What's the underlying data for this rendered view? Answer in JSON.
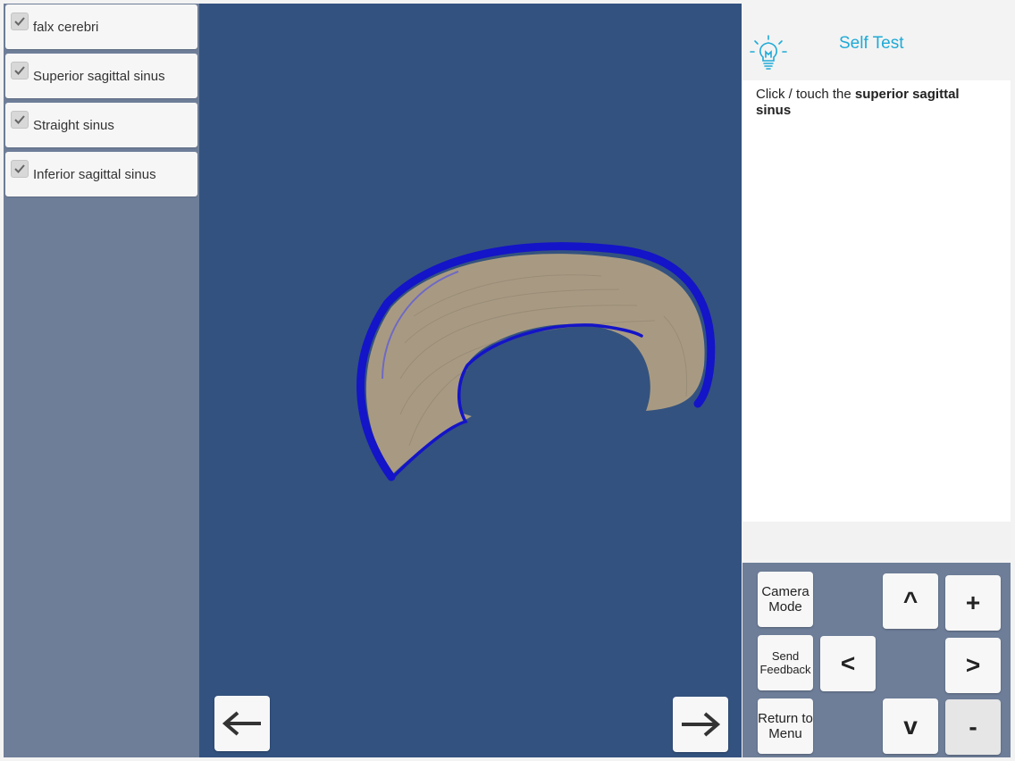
{
  "layers": [
    {
      "label": "falx cerebri",
      "checked": true
    },
    {
      "label": "Superior sagittal sinus",
      "checked": true
    },
    {
      "label": "Straight sinus",
      "checked": true
    },
    {
      "label": "Inferior sagittal sinus",
      "checked": true
    }
  ],
  "self_test": {
    "title": "Self Test",
    "icon": "lightbulb-icon",
    "prompt_prefix": "Click / touch the ",
    "prompt_target": "superior sagittal sinus"
  },
  "controls": {
    "camera_mode": "Camera Mode",
    "send_feedback": "Send Feedback",
    "return_to_menu": "Return to Menu",
    "up": "^",
    "down": "v",
    "left": "<",
    "right": ">",
    "zoom_in": "+",
    "zoom_out": "-"
  },
  "navigation": {
    "back_icon": "arrow-left-icon",
    "forward_icon": "arrow-right-icon"
  },
  "colors": {
    "viewport_bg": "#33527f",
    "panel_bg": "#6e7e99",
    "accent": "#1faad7",
    "sinus_blue": "#1414c8",
    "falx_tan": "#a89a82"
  }
}
